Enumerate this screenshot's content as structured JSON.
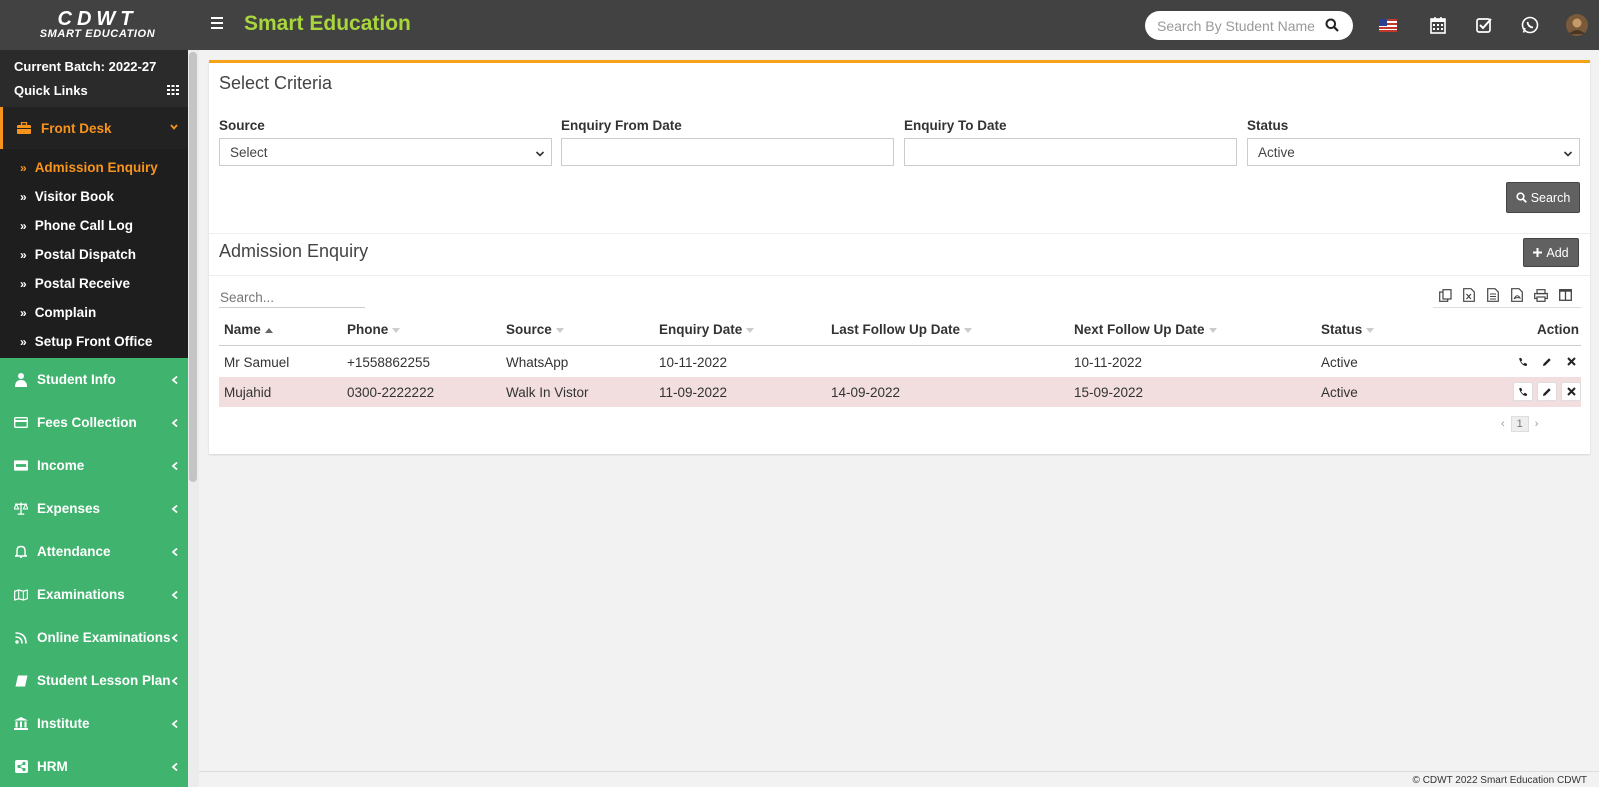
{
  "header": {
    "logo_top": "CDWT",
    "logo_bottom": "SMART EDUCATION",
    "app_title": "Smart Education",
    "search_placeholder": "Search By Student Name",
    "icons": [
      "us-flag-icon",
      "calendar-icon",
      "checklist-icon",
      "whatsapp-icon",
      "user-avatar"
    ]
  },
  "sidebar": {
    "batch": "Current Batch: 2022-27",
    "quick_links": "Quick Links",
    "active_menu": "Front Desk",
    "submenu": [
      {
        "label": "Admission Enquiry",
        "active": true
      },
      {
        "label": "Visitor Book"
      },
      {
        "label": "Phone Call Log"
      },
      {
        "label": "Postal Dispatch"
      },
      {
        "label": "Postal Receive"
      },
      {
        "label": "Complain"
      },
      {
        "label": "Setup Front Office"
      }
    ],
    "menu": [
      {
        "label": "Student Info",
        "icon": "user-tie-icon"
      },
      {
        "label": "Fees Collection",
        "icon": "credit-card-icon"
      },
      {
        "label": "Income",
        "icon": "visa-card-icon"
      },
      {
        "label": "Expenses",
        "icon": "balance-scale-icon"
      },
      {
        "label": "Attendance",
        "icon": "bell-icon"
      },
      {
        "label": "Examinations",
        "icon": "map-icon"
      },
      {
        "label": "Online Examinations",
        "icon": "rss-icon"
      },
      {
        "label": "Student Lesson Plan",
        "icon": "book-icon"
      },
      {
        "label": "Institute",
        "icon": "bank-icon"
      },
      {
        "label": "HRM",
        "icon": "share-icon"
      }
    ]
  },
  "criteria": {
    "title": "Select Criteria",
    "source_label": "Source",
    "source_value": "Select",
    "from_label": "Enquiry From Date",
    "from_value": "",
    "to_label": "Enquiry To Date",
    "to_value": "",
    "status_label": "Status",
    "status_value": "Active",
    "search_button": "Search"
  },
  "enquiry": {
    "title": "Admission Enquiry",
    "add_button": "Add",
    "table_search_placeholder": "Search...",
    "columns": [
      "Name",
      "Phone",
      "Source",
      "Enquiry Date",
      "Last Follow Up Date",
      "Next Follow Up Date",
      "Status",
      "Action"
    ],
    "rows": [
      {
        "name": "Mr Samuel",
        "phone": "+1558862255",
        "source": "WhatsApp",
        "enquiry_date": "10-11-2022",
        "last_follow_up": "",
        "next_follow_up": "10-11-2022",
        "status": "Active"
      },
      {
        "name": "Mujahid",
        "phone": "0300-2222222",
        "source": "Walk In Vistor",
        "enquiry_date": "11-09-2022",
        "last_follow_up": "14-09-2022",
        "next_follow_up": "15-09-2022",
        "status": "Active"
      }
    ],
    "page": "1"
  },
  "footer": "© CDWT 2022 Smart Education CDWT",
  "colors": {
    "accent_green": "#a8d63c",
    "sidebar_green": "#40b46f",
    "orange": "#f7941d",
    "header": "#424242"
  }
}
